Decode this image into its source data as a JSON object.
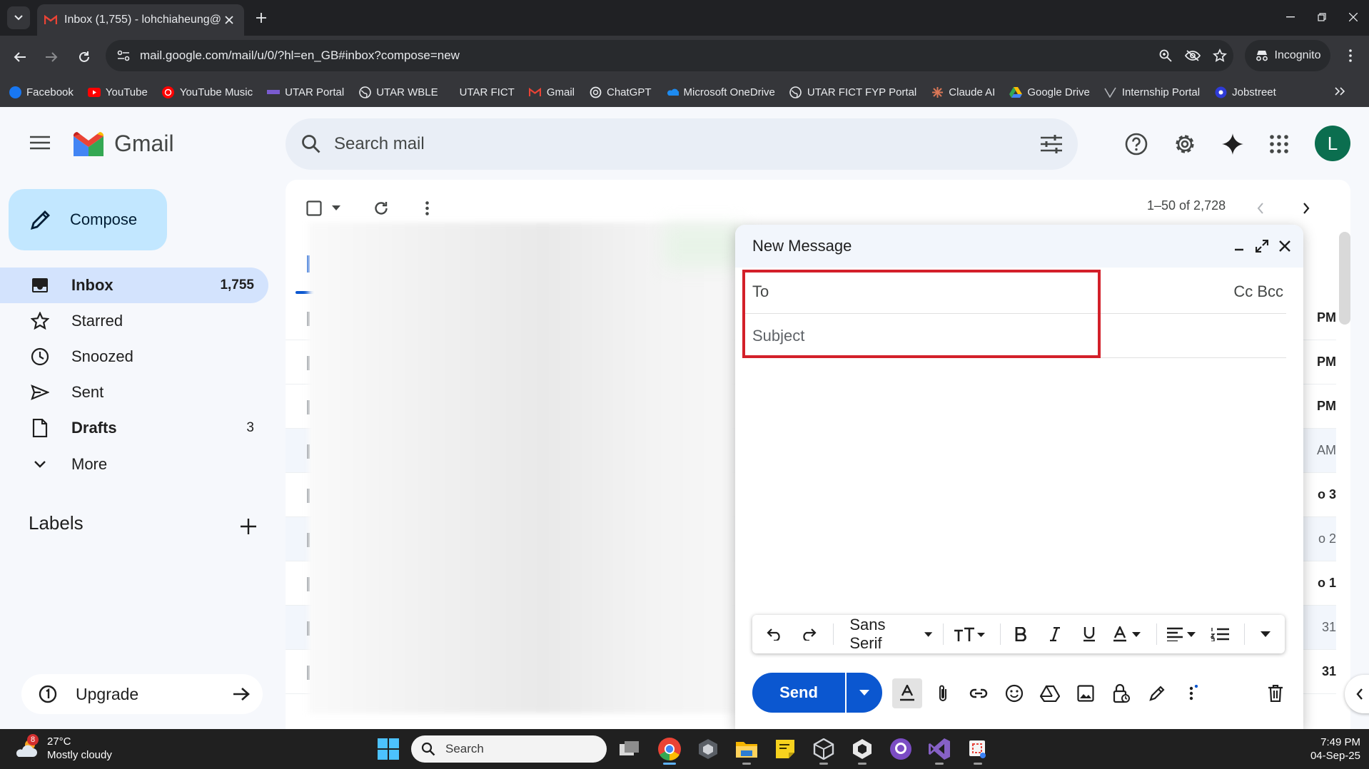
{
  "browser": {
    "tab_title": "Inbox (1,755) - lohchiaheung@",
    "url": "mail.google.com/mail/u/0/?hl=en_GB#inbox?compose=new",
    "incognito_label": "Incognito",
    "bookmarks": [
      "Facebook",
      "YouTube",
      "YouTube Music",
      "UTAR Portal",
      "UTAR WBLE",
      "UTAR FICT",
      "Gmail",
      "ChatGPT",
      "Microsoft OneDrive",
      "UTAR FICT FYP Portal",
      "Claude AI",
      "Google Drive",
      "Internship Portal",
      "Jobstreet"
    ]
  },
  "gmail": {
    "brand": "Gmail",
    "search_placeholder": "Search mail",
    "avatar_letter": "L",
    "compose_label": "Compose",
    "nav": {
      "inbox": {
        "label": "Inbox",
        "count": "1,755"
      },
      "starred": {
        "label": "Starred"
      },
      "snoozed": {
        "label": "Snoozed"
      },
      "sent": {
        "label": "Sent"
      },
      "drafts": {
        "label": "Drafts",
        "count": "3"
      },
      "more": {
        "label": "More"
      }
    },
    "labels_heading": "Labels",
    "upgrade_label": "Upgrade",
    "pagination": "1–50 of 2,728",
    "row_dates": [
      "PM",
      "PM",
      "PM",
      "AM",
      "o 3",
      "o 2",
      "o 1",
      "31",
      "31"
    ]
  },
  "compose": {
    "title": "New Message",
    "to_label": "To",
    "cc_bcc": "Cc Bcc",
    "subject_placeholder": "Subject",
    "font_name": "Sans Serif",
    "send_label": "Send"
  },
  "taskbar": {
    "weather_badge": "8",
    "weather_temp": "27°C",
    "weather_desc": "Mostly cloudy",
    "search_placeholder": "Search",
    "time": "7:49 PM",
    "date": "04-Sep-25"
  },
  "colors": {
    "accent_blue": "#0b57d0",
    "compose_bg": "#c2e7ff",
    "active_nav": "#d3e3fd",
    "highlight_red": "#d3202a",
    "avatar_green": "#0b6e4f"
  }
}
